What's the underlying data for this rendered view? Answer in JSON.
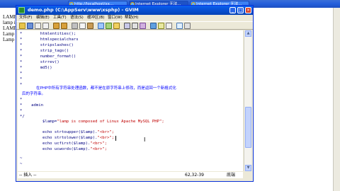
{
  "taskbar": {
    "tasks": [
      {
        "label": "http://localhost/xx..."
      },
      {
        "label": "Internet Explorer 无法..."
      },
      {
        "label": "Internet Explorer 无法..."
      }
    ]
  },
  "browser": {
    "lines": [
      "LAMP IS C",
      "lamp is com",
      "LAMP is com",
      "Lamp Is Com",
      "Lamp Is Co"
    ]
  },
  "window": {
    "title": "demo.php (C:\\AppServ\\www\\xsphp) - GVIM",
    "buttons": {
      "minimize": "_",
      "maximize": "□",
      "close": "×"
    }
  },
  "menubar": {
    "items": [
      "文件(F)",
      "编辑(E)",
      "工具(T)",
      "语法(S)",
      "缓冲区(B)",
      "窗口(W)",
      "帮助(H)"
    ]
  },
  "editor": {
    "func_lines": [
      "htmlentities();",
      "htmlspecialchars",
      "stripslashes()",
      "strip_tags()",
      "number_format()",
      "strrev()",
      "md5()"
    ],
    "comment_1": "在PHP中所有字符串处理函数，都不是在原字符串上修改，而是返回一个新格式化",
    "comment_2": "后的字符串。",
    "author": "admin",
    "close_comment": "*/",
    "assign_var": "$lamp=",
    "assign_str": "\"lamp is composed of Linux Apache MySQL PHP\";",
    "echo_lines": [
      {
        "code": "echo strtoupper($lamp).",
        "str": "\"<br>\";"
      },
      {
        "code": "echo strtolower($lamp).",
        "str": "\"<br>\";"
      },
      {
        "code": "echo ucfirst($lamp).",
        "str": "\"<br>\";"
      },
      {
        "code": "echo ucwords($lamp).",
        "str": "\"<br>\";"
      }
    ]
  },
  "statusbar": {
    "mode": "-- 插入 --",
    "position": "62,32-39",
    "scroll": "底端"
  }
}
